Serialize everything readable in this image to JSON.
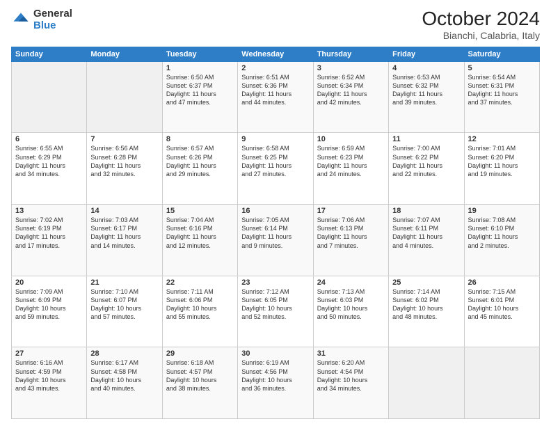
{
  "logo": {
    "general": "General",
    "blue": "Blue"
  },
  "title": {
    "month_year": "October 2024",
    "location": "Bianchi, Calabria, Italy"
  },
  "weekdays": [
    "Sunday",
    "Monday",
    "Tuesday",
    "Wednesday",
    "Thursday",
    "Friday",
    "Saturday"
  ],
  "weeks": [
    [
      {
        "day": "",
        "info": ""
      },
      {
        "day": "",
        "info": ""
      },
      {
        "day": "1",
        "info": "Sunrise: 6:50 AM\nSunset: 6:37 PM\nDaylight: 11 hours\nand 47 minutes."
      },
      {
        "day": "2",
        "info": "Sunrise: 6:51 AM\nSunset: 6:36 PM\nDaylight: 11 hours\nand 44 minutes."
      },
      {
        "day": "3",
        "info": "Sunrise: 6:52 AM\nSunset: 6:34 PM\nDaylight: 11 hours\nand 42 minutes."
      },
      {
        "day": "4",
        "info": "Sunrise: 6:53 AM\nSunset: 6:32 PM\nDaylight: 11 hours\nand 39 minutes."
      },
      {
        "day": "5",
        "info": "Sunrise: 6:54 AM\nSunset: 6:31 PM\nDaylight: 11 hours\nand 37 minutes."
      }
    ],
    [
      {
        "day": "6",
        "info": "Sunrise: 6:55 AM\nSunset: 6:29 PM\nDaylight: 11 hours\nand 34 minutes."
      },
      {
        "day": "7",
        "info": "Sunrise: 6:56 AM\nSunset: 6:28 PM\nDaylight: 11 hours\nand 32 minutes."
      },
      {
        "day": "8",
        "info": "Sunrise: 6:57 AM\nSunset: 6:26 PM\nDaylight: 11 hours\nand 29 minutes."
      },
      {
        "day": "9",
        "info": "Sunrise: 6:58 AM\nSunset: 6:25 PM\nDaylight: 11 hours\nand 27 minutes."
      },
      {
        "day": "10",
        "info": "Sunrise: 6:59 AM\nSunset: 6:23 PM\nDaylight: 11 hours\nand 24 minutes."
      },
      {
        "day": "11",
        "info": "Sunrise: 7:00 AM\nSunset: 6:22 PM\nDaylight: 11 hours\nand 22 minutes."
      },
      {
        "day": "12",
        "info": "Sunrise: 7:01 AM\nSunset: 6:20 PM\nDaylight: 11 hours\nand 19 minutes."
      }
    ],
    [
      {
        "day": "13",
        "info": "Sunrise: 7:02 AM\nSunset: 6:19 PM\nDaylight: 11 hours\nand 17 minutes."
      },
      {
        "day": "14",
        "info": "Sunrise: 7:03 AM\nSunset: 6:17 PM\nDaylight: 11 hours\nand 14 minutes."
      },
      {
        "day": "15",
        "info": "Sunrise: 7:04 AM\nSunset: 6:16 PM\nDaylight: 11 hours\nand 12 minutes."
      },
      {
        "day": "16",
        "info": "Sunrise: 7:05 AM\nSunset: 6:14 PM\nDaylight: 11 hours\nand 9 minutes."
      },
      {
        "day": "17",
        "info": "Sunrise: 7:06 AM\nSunset: 6:13 PM\nDaylight: 11 hours\nand 7 minutes."
      },
      {
        "day": "18",
        "info": "Sunrise: 7:07 AM\nSunset: 6:11 PM\nDaylight: 11 hours\nand 4 minutes."
      },
      {
        "day": "19",
        "info": "Sunrise: 7:08 AM\nSunset: 6:10 PM\nDaylight: 11 hours\nand 2 minutes."
      }
    ],
    [
      {
        "day": "20",
        "info": "Sunrise: 7:09 AM\nSunset: 6:09 PM\nDaylight: 10 hours\nand 59 minutes."
      },
      {
        "day": "21",
        "info": "Sunrise: 7:10 AM\nSunset: 6:07 PM\nDaylight: 10 hours\nand 57 minutes."
      },
      {
        "day": "22",
        "info": "Sunrise: 7:11 AM\nSunset: 6:06 PM\nDaylight: 10 hours\nand 55 minutes."
      },
      {
        "day": "23",
        "info": "Sunrise: 7:12 AM\nSunset: 6:05 PM\nDaylight: 10 hours\nand 52 minutes."
      },
      {
        "day": "24",
        "info": "Sunrise: 7:13 AM\nSunset: 6:03 PM\nDaylight: 10 hours\nand 50 minutes."
      },
      {
        "day": "25",
        "info": "Sunrise: 7:14 AM\nSunset: 6:02 PM\nDaylight: 10 hours\nand 48 minutes."
      },
      {
        "day": "26",
        "info": "Sunrise: 7:15 AM\nSunset: 6:01 PM\nDaylight: 10 hours\nand 45 minutes."
      }
    ],
    [
      {
        "day": "27",
        "info": "Sunrise: 6:16 AM\nSunset: 4:59 PM\nDaylight: 10 hours\nand 43 minutes."
      },
      {
        "day": "28",
        "info": "Sunrise: 6:17 AM\nSunset: 4:58 PM\nDaylight: 10 hours\nand 40 minutes."
      },
      {
        "day": "29",
        "info": "Sunrise: 6:18 AM\nSunset: 4:57 PM\nDaylight: 10 hours\nand 38 minutes."
      },
      {
        "day": "30",
        "info": "Sunrise: 6:19 AM\nSunset: 4:56 PM\nDaylight: 10 hours\nand 36 minutes."
      },
      {
        "day": "31",
        "info": "Sunrise: 6:20 AM\nSunset: 4:54 PM\nDaylight: 10 hours\nand 34 minutes."
      },
      {
        "day": "",
        "info": ""
      },
      {
        "day": "",
        "info": ""
      }
    ]
  ]
}
